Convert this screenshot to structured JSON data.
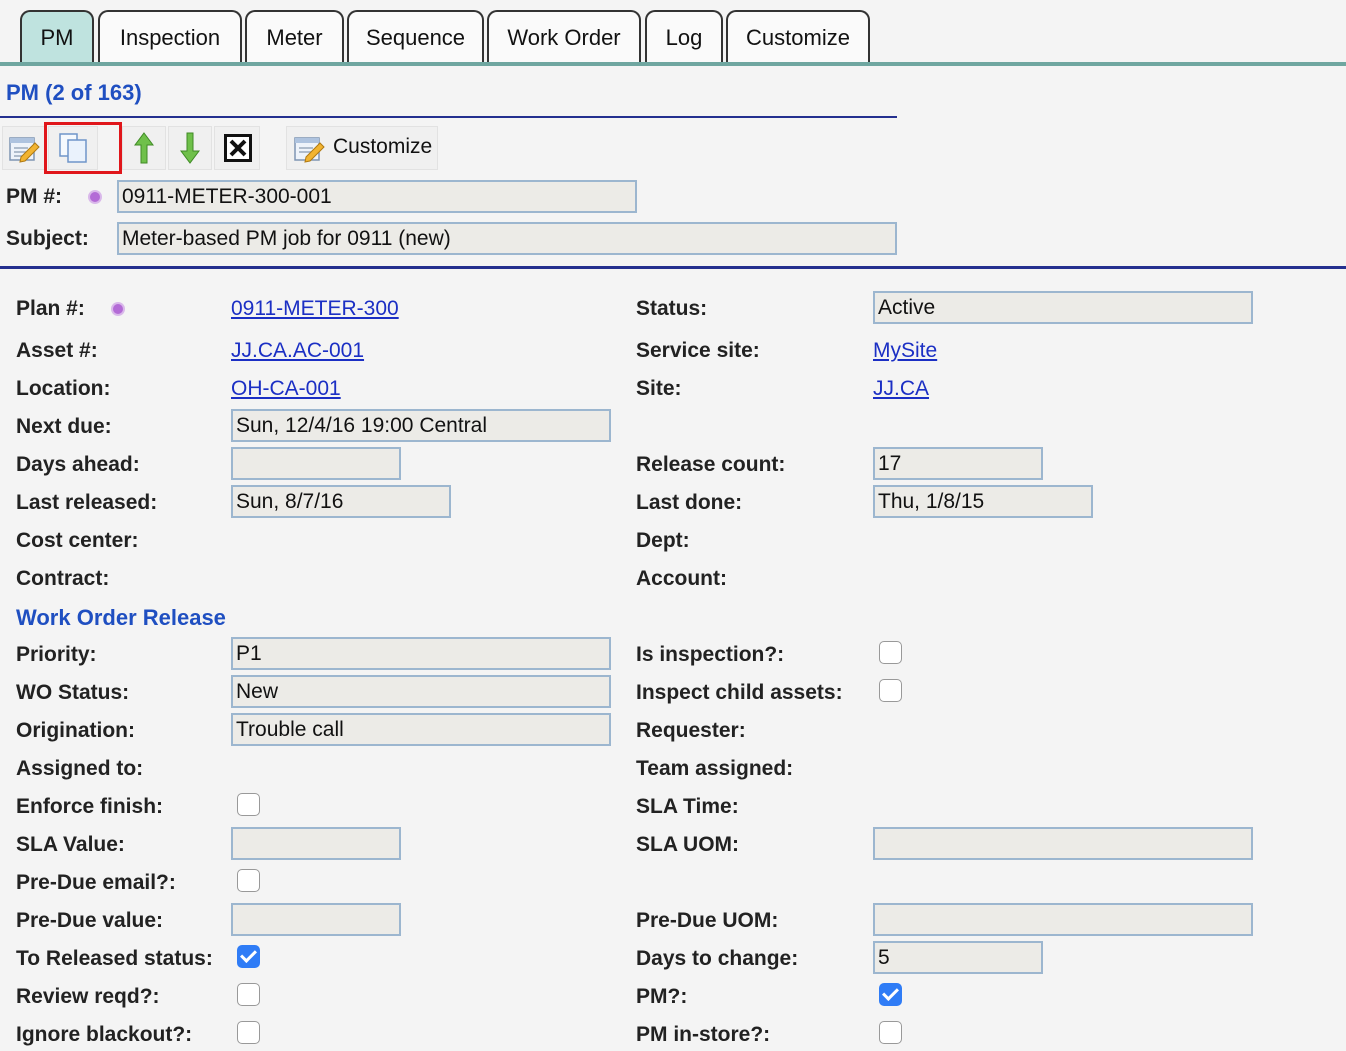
{
  "tabs": [
    {
      "label": "PM",
      "active": true
    },
    {
      "label": "Inspection",
      "active": false
    },
    {
      "label": "Meter",
      "active": false
    },
    {
      "label": "Sequence",
      "active": false
    },
    {
      "label": "Work Order",
      "active": false
    },
    {
      "label": "Log",
      "active": false
    },
    {
      "label": "Customize",
      "active": false
    }
  ],
  "header": {
    "title": "PM (2 of 163)",
    "toolbar": {
      "customize_label": "Customize",
      "icons": [
        "edit-icon",
        "copy-icon",
        "move-up-icon",
        "move-down-icon",
        "delete-icon",
        "customize-icon"
      ]
    },
    "pm_number": {
      "label": "PM #:",
      "value": "0911-METER-300-001"
    },
    "subject": {
      "label": "Subject:",
      "value": "Meter-based PM job for 0911 (new)"
    }
  },
  "details": {
    "plan": {
      "label": "Plan #:",
      "value": "0911-METER-300"
    },
    "status": {
      "label": "Status:",
      "value": "Active"
    },
    "asset": {
      "label": "Asset #:",
      "value": "JJ.CA.AC-001"
    },
    "service_site": {
      "label": "Service site:",
      "value": "MySite"
    },
    "location": {
      "label": "Location:",
      "value": "OH-CA-001"
    },
    "site": {
      "label": "Site:",
      "value": "JJ.CA"
    },
    "next_due": {
      "label": "Next due:",
      "value": "Sun, 12/4/16 19:00 Central"
    },
    "days_ahead": {
      "label": "Days ahead:",
      "value": ""
    },
    "release_count": {
      "label": "Release count:",
      "value": "17"
    },
    "last_released": {
      "label": "Last released:",
      "value": "Sun, 8/7/16"
    },
    "last_done": {
      "label": "Last done:",
      "value": "Thu, 1/8/15"
    },
    "cost_center": {
      "label": "Cost center:"
    },
    "dept": {
      "label": "Dept:"
    },
    "contract": {
      "label": "Contract:"
    },
    "account": {
      "label": "Account:"
    }
  },
  "release": {
    "heading": "Work Order Release",
    "priority": {
      "label": "Priority:",
      "value": "P1"
    },
    "is_inspection": {
      "label": "Is inspection?:",
      "checked": false
    },
    "wo_status": {
      "label": "WO Status:",
      "value": "New"
    },
    "inspect_child": {
      "label": "Inspect child assets:",
      "checked": false
    },
    "origination": {
      "label": "Origination:",
      "value": "Trouble call"
    },
    "requester": {
      "label": "Requester:"
    },
    "assigned_to": {
      "label": "Assigned to:"
    },
    "team_assigned": {
      "label": "Team assigned:"
    },
    "enforce_finish": {
      "label": "Enforce finish:",
      "checked": false
    },
    "sla_time": {
      "label": "SLA Time:"
    },
    "sla_value": {
      "label": "SLA Value:",
      "value": ""
    },
    "sla_uom": {
      "label": "SLA UOM:",
      "value": ""
    },
    "pre_due_email": {
      "label": "Pre-Due email?:",
      "checked": false
    },
    "pre_due_value": {
      "label": "Pre-Due value:",
      "value": ""
    },
    "pre_due_uom": {
      "label": "Pre-Due UOM:",
      "value": ""
    },
    "to_released": {
      "label": "To Released status:",
      "checked": true
    },
    "days_to_change": {
      "label": "Days to change:",
      "value": "5"
    },
    "review_reqd": {
      "label": "Review reqd?:",
      "checked": false
    },
    "pm_flag": {
      "label": "PM?:",
      "checked": true
    },
    "ignore_blackout": {
      "label": "Ignore blackout?:",
      "checked": false
    },
    "pm_in_store": {
      "label": "PM in-store?:",
      "checked": false
    }
  }
}
